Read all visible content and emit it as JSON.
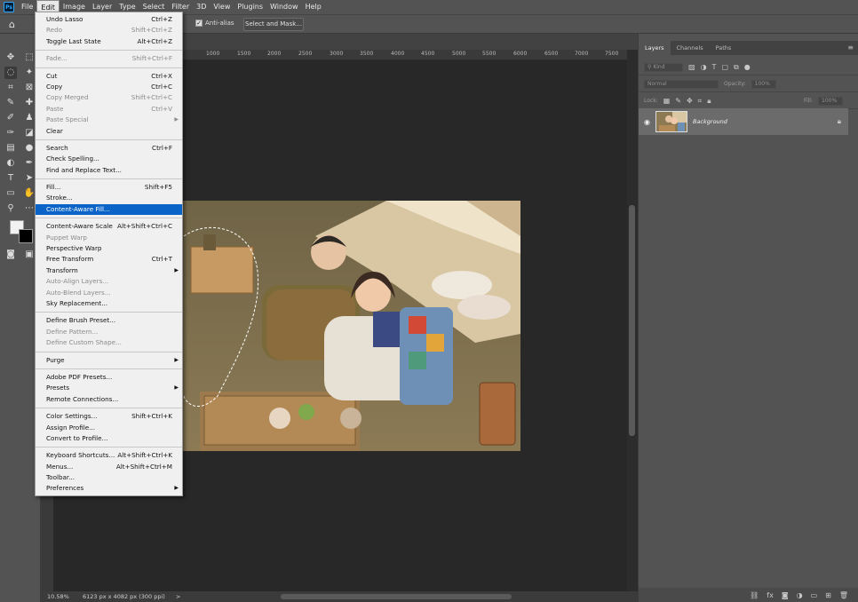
{
  "menubar": {
    "items": [
      "File",
      "Edit",
      "Image",
      "Layer",
      "Type",
      "Select",
      "Filter",
      "3D",
      "View",
      "Plugins",
      "Window",
      "Help"
    ],
    "active": "Edit"
  },
  "options": {
    "antialias": "Anti-alias",
    "select_mask": "Select and Mask..."
  },
  "ruler": {
    "ticks": [
      "1000",
      "1500",
      "2000",
      "2500",
      "3000",
      "3500",
      "4000",
      "4500",
      "5000",
      "5500",
      "6000",
      "6500",
      "7000",
      "7500"
    ]
  },
  "status": {
    "zoom": "10.58%",
    "docinfo": "6123 px x 4082 px (300 ppi)",
    "arrow": ">"
  },
  "layers_panel": {
    "tabs": [
      "Layers",
      "Channels",
      "Paths"
    ],
    "kind": "Kind",
    "blend": "Normal",
    "opacity_label": "Opacity:",
    "opacity": "100%",
    "lock_label": "Lock:",
    "fill_label": "Fill:",
    "fill": "100%",
    "layer_name": "Background"
  },
  "edit_menu": [
    {
      "label": "Undo Lasso",
      "shortcut": "Ctrl+Z"
    },
    {
      "label": "Redo",
      "shortcut": "Shift+Ctrl+Z",
      "disabled": true
    },
    {
      "label": "Toggle Last State",
      "shortcut": "Alt+Ctrl+Z"
    },
    {
      "sep": true
    },
    {
      "label": "Fade...",
      "shortcut": "Shift+Ctrl+F",
      "disabled": true
    },
    {
      "sep": true
    },
    {
      "label": "Cut",
      "shortcut": "Ctrl+X"
    },
    {
      "label": "Copy",
      "shortcut": "Ctrl+C"
    },
    {
      "label": "Copy Merged",
      "shortcut": "Shift+Ctrl+C",
      "disabled": true
    },
    {
      "label": "Paste",
      "shortcut": "Ctrl+V",
      "disabled": true
    },
    {
      "label": "Paste Special",
      "submenu": true,
      "disabled": true
    },
    {
      "label": "Clear"
    },
    {
      "sep": true
    },
    {
      "label": "Search",
      "shortcut": "Ctrl+F"
    },
    {
      "label": "Check Spelling..."
    },
    {
      "label": "Find and Replace Text..."
    },
    {
      "sep": true
    },
    {
      "label": "Fill...",
      "shortcut": "Shift+F5"
    },
    {
      "label": "Stroke..."
    },
    {
      "label": "Content-Aware Fill...",
      "highlight": true
    },
    {
      "sep": true
    },
    {
      "label": "Content-Aware Scale",
      "shortcut": "Alt+Shift+Ctrl+C"
    },
    {
      "label": "Puppet Warp",
      "disabled": true
    },
    {
      "label": "Perspective Warp"
    },
    {
      "label": "Free Transform",
      "shortcut": "Ctrl+T"
    },
    {
      "label": "Transform",
      "submenu": true
    },
    {
      "label": "Auto-Align Layers...",
      "disabled": true
    },
    {
      "label": "Auto-Blend Layers...",
      "disabled": true
    },
    {
      "label": "Sky Replacement..."
    },
    {
      "sep": true
    },
    {
      "label": "Define Brush Preset..."
    },
    {
      "label": "Define Pattern...",
      "disabled": true
    },
    {
      "label": "Define Custom Shape...",
      "disabled": true
    },
    {
      "sep": true
    },
    {
      "label": "Purge",
      "submenu": true
    },
    {
      "sep": true
    },
    {
      "label": "Adobe PDF Presets..."
    },
    {
      "label": "Presets",
      "submenu": true
    },
    {
      "label": "Remote Connections..."
    },
    {
      "sep": true
    },
    {
      "label": "Color Settings...",
      "shortcut": "Shift+Ctrl+K"
    },
    {
      "label": "Assign Profile..."
    },
    {
      "label": "Convert to Profile..."
    },
    {
      "sep": true
    },
    {
      "label": "Keyboard Shortcuts...",
      "shortcut": "Alt+Shift+Ctrl+K"
    },
    {
      "label": "Menus...",
      "shortcut": "Alt+Shift+Ctrl+M"
    },
    {
      "label": "Toolbar..."
    },
    {
      "label": "Preferences",
      "submenu": true
    }
  ]
}
